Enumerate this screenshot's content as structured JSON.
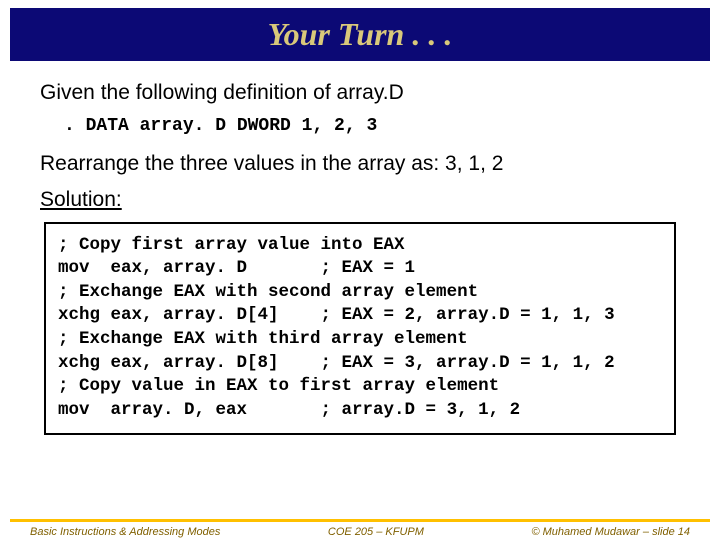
{
  "title": "Your Turn . . .",
  "intro": "Given the following definition of array.D",
  "code_def": ". DATA\narray. D DWORD 1, 2, 3",
  "rearrange": "Rearrange the three values in the array as: 3, 1, 2",
  "solution_label": "Solution:",
  "code_box": "; Copy first array value into EAX\nmov  eax, array. D       ; EAX = 1\n; Exchange EAX with second array element\nxchg eax, array. D[4]    ; EAX = 2, array.D = 1, 1, 3\n; Exchange EAX with third array element\nxchg eax, array. D[8]    ; EAX = 3, array.D = 1, 1, 2\n; Copy value in EAX to first array element\nmov  array. D, eax       ; array.D = 3, 1, 2",
  "footer": {
    "left": "Basic Instructions & Addressing Modes",
    "center": "COE 205 – KFUPM",
    "right": "© Muhamed Mudawar – slide 14"
  }
}
